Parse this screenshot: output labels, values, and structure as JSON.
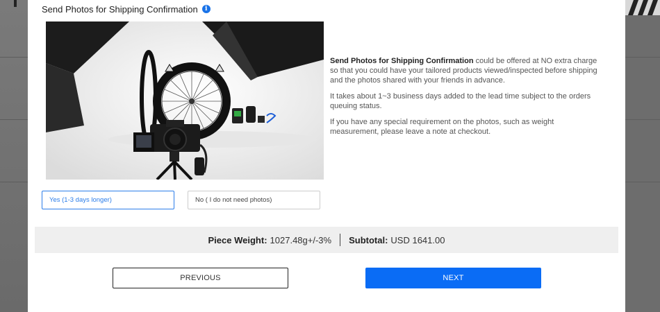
{
  "modal": {
    "title": "Send Photos for Shipping Confirmation",
    "info_icon": "info-icon"
  },
  "description": {
    "p1_bold": "Send Photos for Shipping Confirmation",
    "p1_rest": " could be offered at NO extra charge so that you could have your tailored products viewed/inspected before shipping and the photos shared with your friends in advance.",
    "p2": "It takes about 1~3 business days added to the lead time subject to the orders queuing status.",
    "p3": "If you have any special requirement on the photos, such as weight measurement, please leave a note at checkout."
  },
  "options": [
    {
      "label": "Yes (1-3 days longer)",
      "selected": true
    },
    {
      "label": "No ( I do not need photos)",
      "selected": false
    }
  ],
  "summary": {
    "weight_label": "Piece Weight:",
    "weight_value": "1027.48g+/-3%",
    "subtotal_label": "Subtotal:",
    "subtotal_value": "USD 1641.00"
  },
  "buttons": {
    "previous": "PREVIOUS",
    "next": "NEXT"
  },
  "colors": {
    "accent": "#0a6cf5",
    "selected_option": "#2b7de9",
    "summary_bg": "#efefef"
  }
}
